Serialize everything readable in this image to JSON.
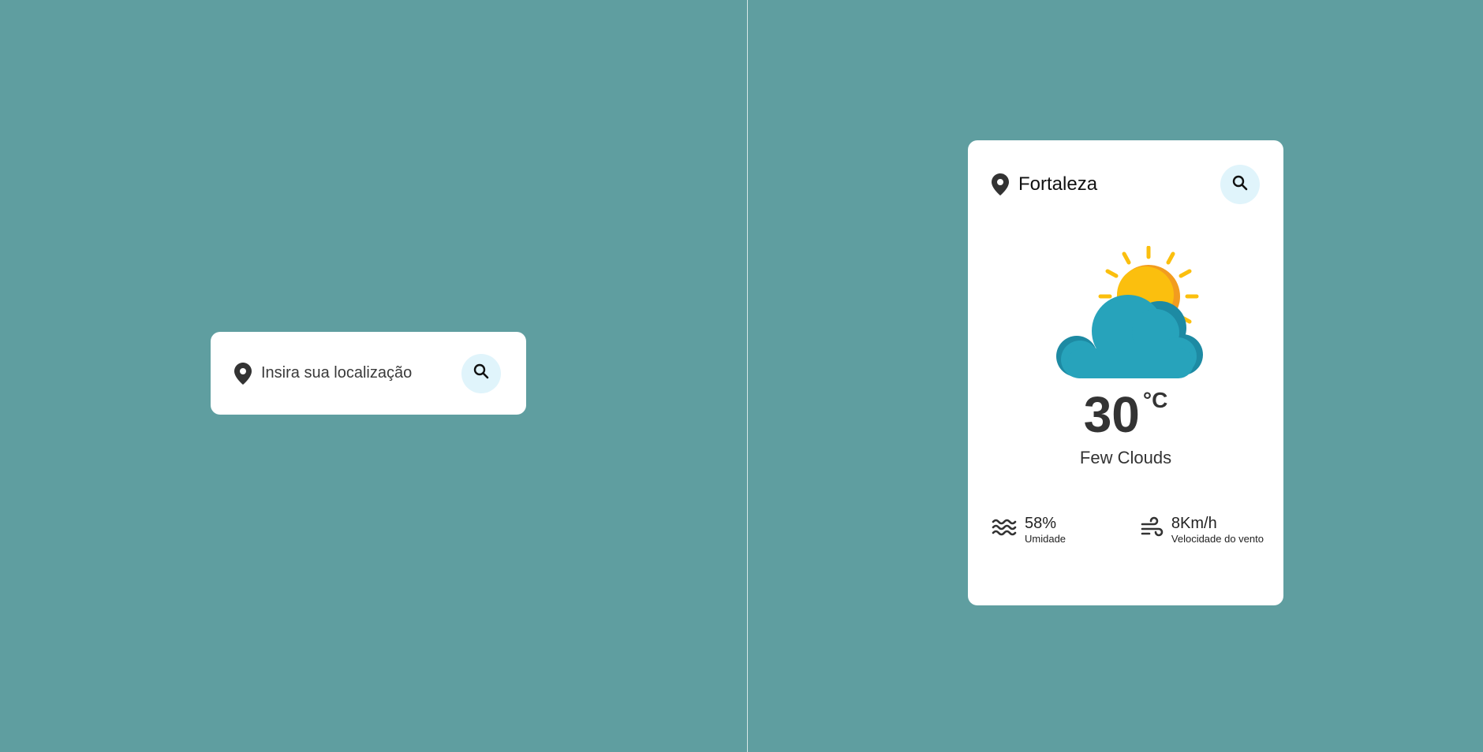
{
  "search": {
    "placeholder": "Insira sua localização"
  },
  "weather": {
    "city": "Fortaleza",
    "temperature": "30",
    "unit": "°C",
    "condition": "Few Clouds",
    "icon": "sun-behind-cloud-icon",
    "humidity": {
      "value": "58%",
      "label": "Umidade",
      "icon": "humidity-waves-icon"
    },
    "wind": {
      "value": "8Km/h",
      "label": "Velocidade do vento",
      "icon": "wind-icon"
    }
  },
  "colors": {
    "background": "#5f9ea0",
    "card": "#ffffff",
    "search_button_bg": "#e0f4fb",
    "sun": "#fbbf0e",
    "sun_shadow": "#f29c1f",
    "cloud": "#27a3bb",
    "cloud_shadow": "#1d8aa3",
    "text": "#333333"
  }
}
